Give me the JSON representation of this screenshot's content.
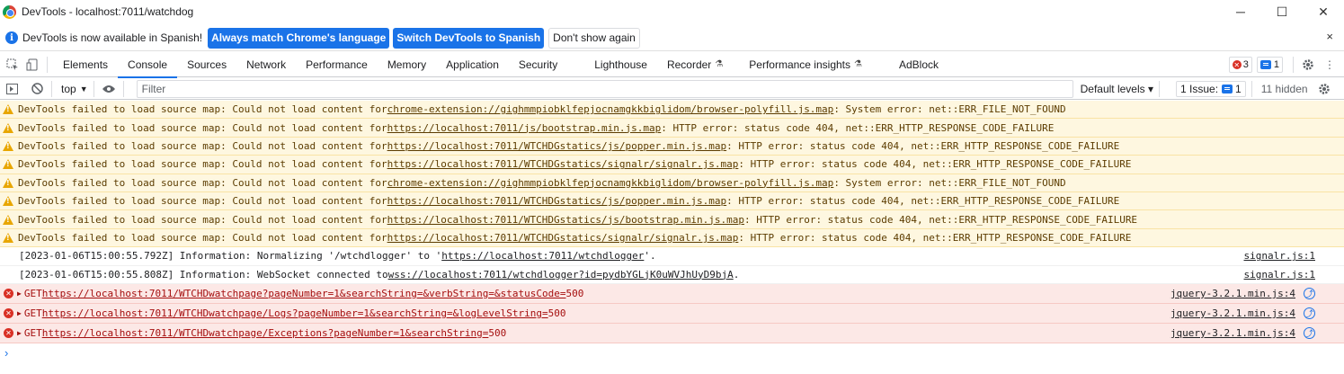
{
  "window": {
    "title": "DevTools - localhost:7011/watchdog",
    "controls": [
      "─",
      "☐",
      "✕"
    ]
  },
  "infobar": {
    "message": "DevTools is now available in Spanish!",
    "btn_match": "Always match Chrome's language",
    "btn_switch": "Switch DevTools to Spanish",
    "btn_dismiss": "Don't show again",
    "close": "×"
  },
  "tabs": [
    {
      "label": "Elements"
    },
    {
      "label": "Console",
      "active": true
    },
    {
      "label": "Sources"
    },
    {
      "label": "Network"
    },
    {
      "label": "Performance"
    },
    {
      "label": "Memory"
    },
    {
      "label": "Application"
    },
    {
      "label": "Security"
    },
    {
      "label": "Lighthouse"
    },
    {
      "label": "Recorder"
    },
    {
      "label": "Performance insights"
    },
    {
      "label": "AdBlock"
    }
  ],
  "tab_right": {
    "error_count": "3",
    "message_count": "1"
  },
  "console_toolbar": {
    "context": "top",
    "filter_placeholder": "Filter",
    "levels": "Default levels ▾",
    "issues": "1 Issue:",
    "issues_count": "1",
    "hidden": "11 hidden"
  },
  "messages": [
    {
      "type": "warning",
      "prefix": "DevTools failed to load source map: Could not load content for ",
      "link": "chrome-extension://gighmmpiobklfepjocnamgkkbiglidom/browser-polyfill.js.map",
      "suffix": ": System error: net::ERR_FILE_NOT_FOUND"
    },
    {
      "type": "warning",
      "prefix": "DevTools failed to load source map: Could not load content for ",
      "link": "https://localhost:7011/js/bootstrap.min.js.map",
      "suffix": ": HTTP error: status code 404, net::ERR_HTTP_RESPONSE_CODE_FAILURE"
    },
    {
      "type": "warning",
      "prefix": "DevTools failed to load source map: Could not load content for ",
      "link": "https://localhost:7011/WTCHDGstatics/js/popper.min.js.map",
      "suffix": ": HTTP error: status code 404, net::ERR_HTTP_RESPONSE_CODE_FAILURE"
    },
    {
      "type": "warning",
      "prefix": "DevTools failed to load source map: Could not load content for ",
      "link": "https://localhost:7011/WTCHDGstatics/signalr/signalr.js.map",
      "suffix": ": HTTP error: status code 404, net::ERR_HTTP_RESPONSE_CODE_FAILURE"
    },
    {
      "type": "warning",
      "prefix": "DevTools failed to load source map: Could not load content for ",
      "link": "chrome-extension://gighmmpiobklfepjocnamgkkbiglidom/browser-polyfill.js.map",
      "suffix": ": System error: net::ERR_FILE_NOT_FOUND"
    },
    {
      "type": "warning",
      "prefix": "DevTools failed to load source map: Could not load content for ",
      "link": "https://localhost:7011/WTCHDGstatics/js/popper.min.js.map",
      "suffix": ": HTTP error: status code 404, net::ERR_HTTP_RESPONSE_CODE_FAILURE"
    },
    {
      "type": "warning",
      "prefix": "DevTools failed to load source map: Could not load content for ",
      "link": "https://localhost:7011/WTCHDGstatics/js/bootstrap.min.js.map",
      "suffix": ": HTTP error: status code 404, net::ERR_HTTP_RESPONSE_CODE_FAILURE"
    },
    {
      "type": "warning",
      "prefix": "DevTools failed to load source map: Could not load content for ",
      "link": "https://localhost:7011/WTCHDGstatics/signalr/signalr.js.map",
      "suffix": ": HTTP error: status code 404, net::ERR_HTTP_RESPONSE_CODE_FAILURE"
    },
    {
      "type": "info",
      "prefix": "[2023-01-06T15:00:55.792Z] Information: Normalizing '/wtchdlogger' to '",
      "link": "https://localhost:7011/wtchdlogger",
      "suffix": "'.",
      "source": "signalr.js:1"
    },
    {
      "type": "info",
      "prefix": "[2023-01-06T15:00:55.808Z] Information: WebSocket connected to ",
      "link": "wss://localhost:7011/wtchdlogger?id=pydbYGLjK0uWVJhUyD9bjA",
      "suffix": ".",
      "source": "signalr.js:1"
    },
    {
      "type": "error",
      "prefix": "GET ",
      "link": "https://localhost:7011/WTCHDwatchpage?pageNumber=1&searchString=&verbString=&statusCode=",
      "suffix": " 500",
      "source": "jquery-3.2.1.min.js:4"
    },
    {
      "type": "error",
      "prefix": "GET ",
      "link": "https://localhost:7011/WTCHDwatchpage/Logs?pageNumber=1&searchString=&logLevelString=",
      "suffix": " 500",
      "source": "jquery-3.2.1.min.js:4"
    },
    {
      "type": "error",
      "prefix": "GET ",
      "link": "https://localhost:7011/WTCHDwatchpage/Exceptions?pageNumber=1&searchString=",
      "suffix": " 500",
      "source": "jquery-3.2.1.min.js:4"
    }
  ],
  "prompt": "›"
}
